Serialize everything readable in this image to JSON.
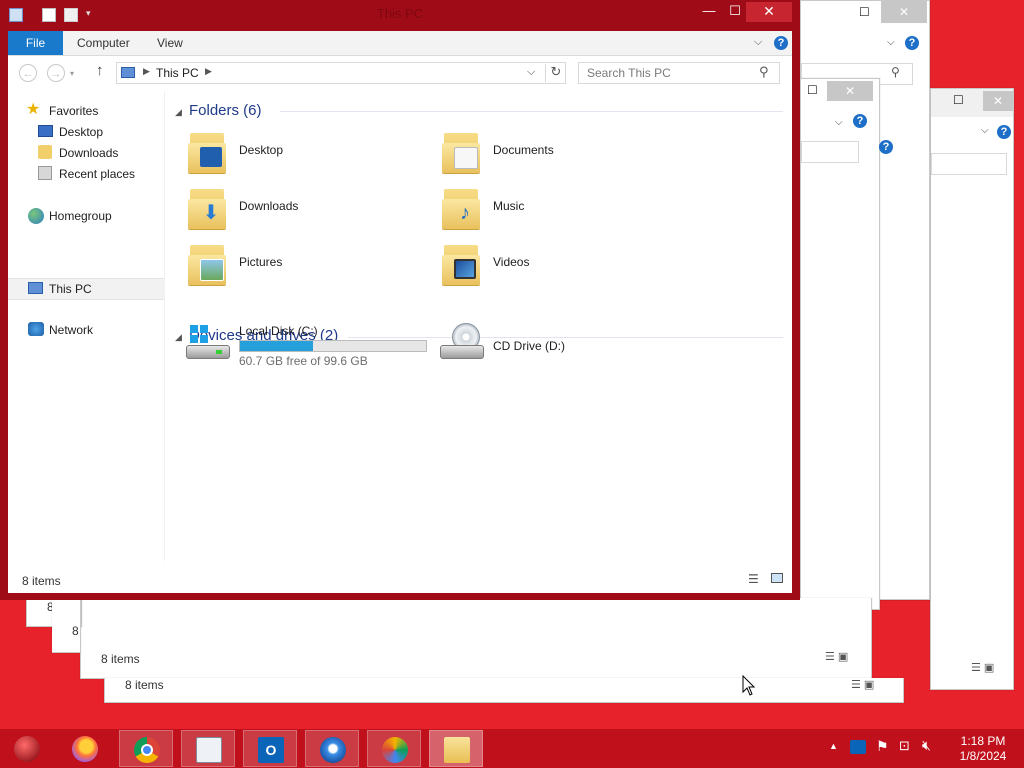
{
  "window": {
    "title": "This PC",
    "min_glyph": "—",
    "max_glyph": "☐",
    "close_glyph": "✕"
  },
  "ribbon": {
    "tabs": [
      "File",
      "Computer",
      "View"
    ],
    "help": "?"
  },
  "navigation": {
    "breadcrumb": "This PC",
    "search_placeholder": "Search This PC"
  },
  "nav_pane": {
    "items": [
      "Favorites",
      "Desktop",
      "Downloads",
      "Recent places",
      "Homegroup",
      "This PC",
      "Network"
    ]
  },
  "folders_group": {
    "title": "Folders (6)",
    "items": [
      "Desktop",
      "Documents",
      "Downloads",
      "Music",
      "Pictures",
      "Videos"
    ]
  },
  "devices_group": {
    "title": "Devices and drives (2)",
    "local_disk": {
      "name": "Local Disk (C:)",
      "free_text": "60.7 GB free of 99.6 GB",
      "used_fraction": 0.39
    },
    "cd_drive": {
      "name": "CD Drive (D:)"
    }
  },
  "status": {
    "items": "8 items"
  },
  "background_windows": {
    "status_1": "8 items",
    "status_2": "8 items",
    "status_3": "8",
    "status_4": "8"
  },
  "taskbar": {
    "apps": [
      "start-orb-icon",
      "firefox-icon",
      "chrome-icon",
      "text-editor-icon",
      "outlook-icon",
      "thunderbird-icon",
      "paint-icon",
      "file-explorer-icon"
    ],
    "time": "1:18 PM",
    "date": "1/8/2024"
  },
  "colors": {
    "desktop": "#e8222a",
    "active_frame": "#9f0c17",
    "accent": "#1979ca",
    "taskbar": "#c0101c"
  }
}
